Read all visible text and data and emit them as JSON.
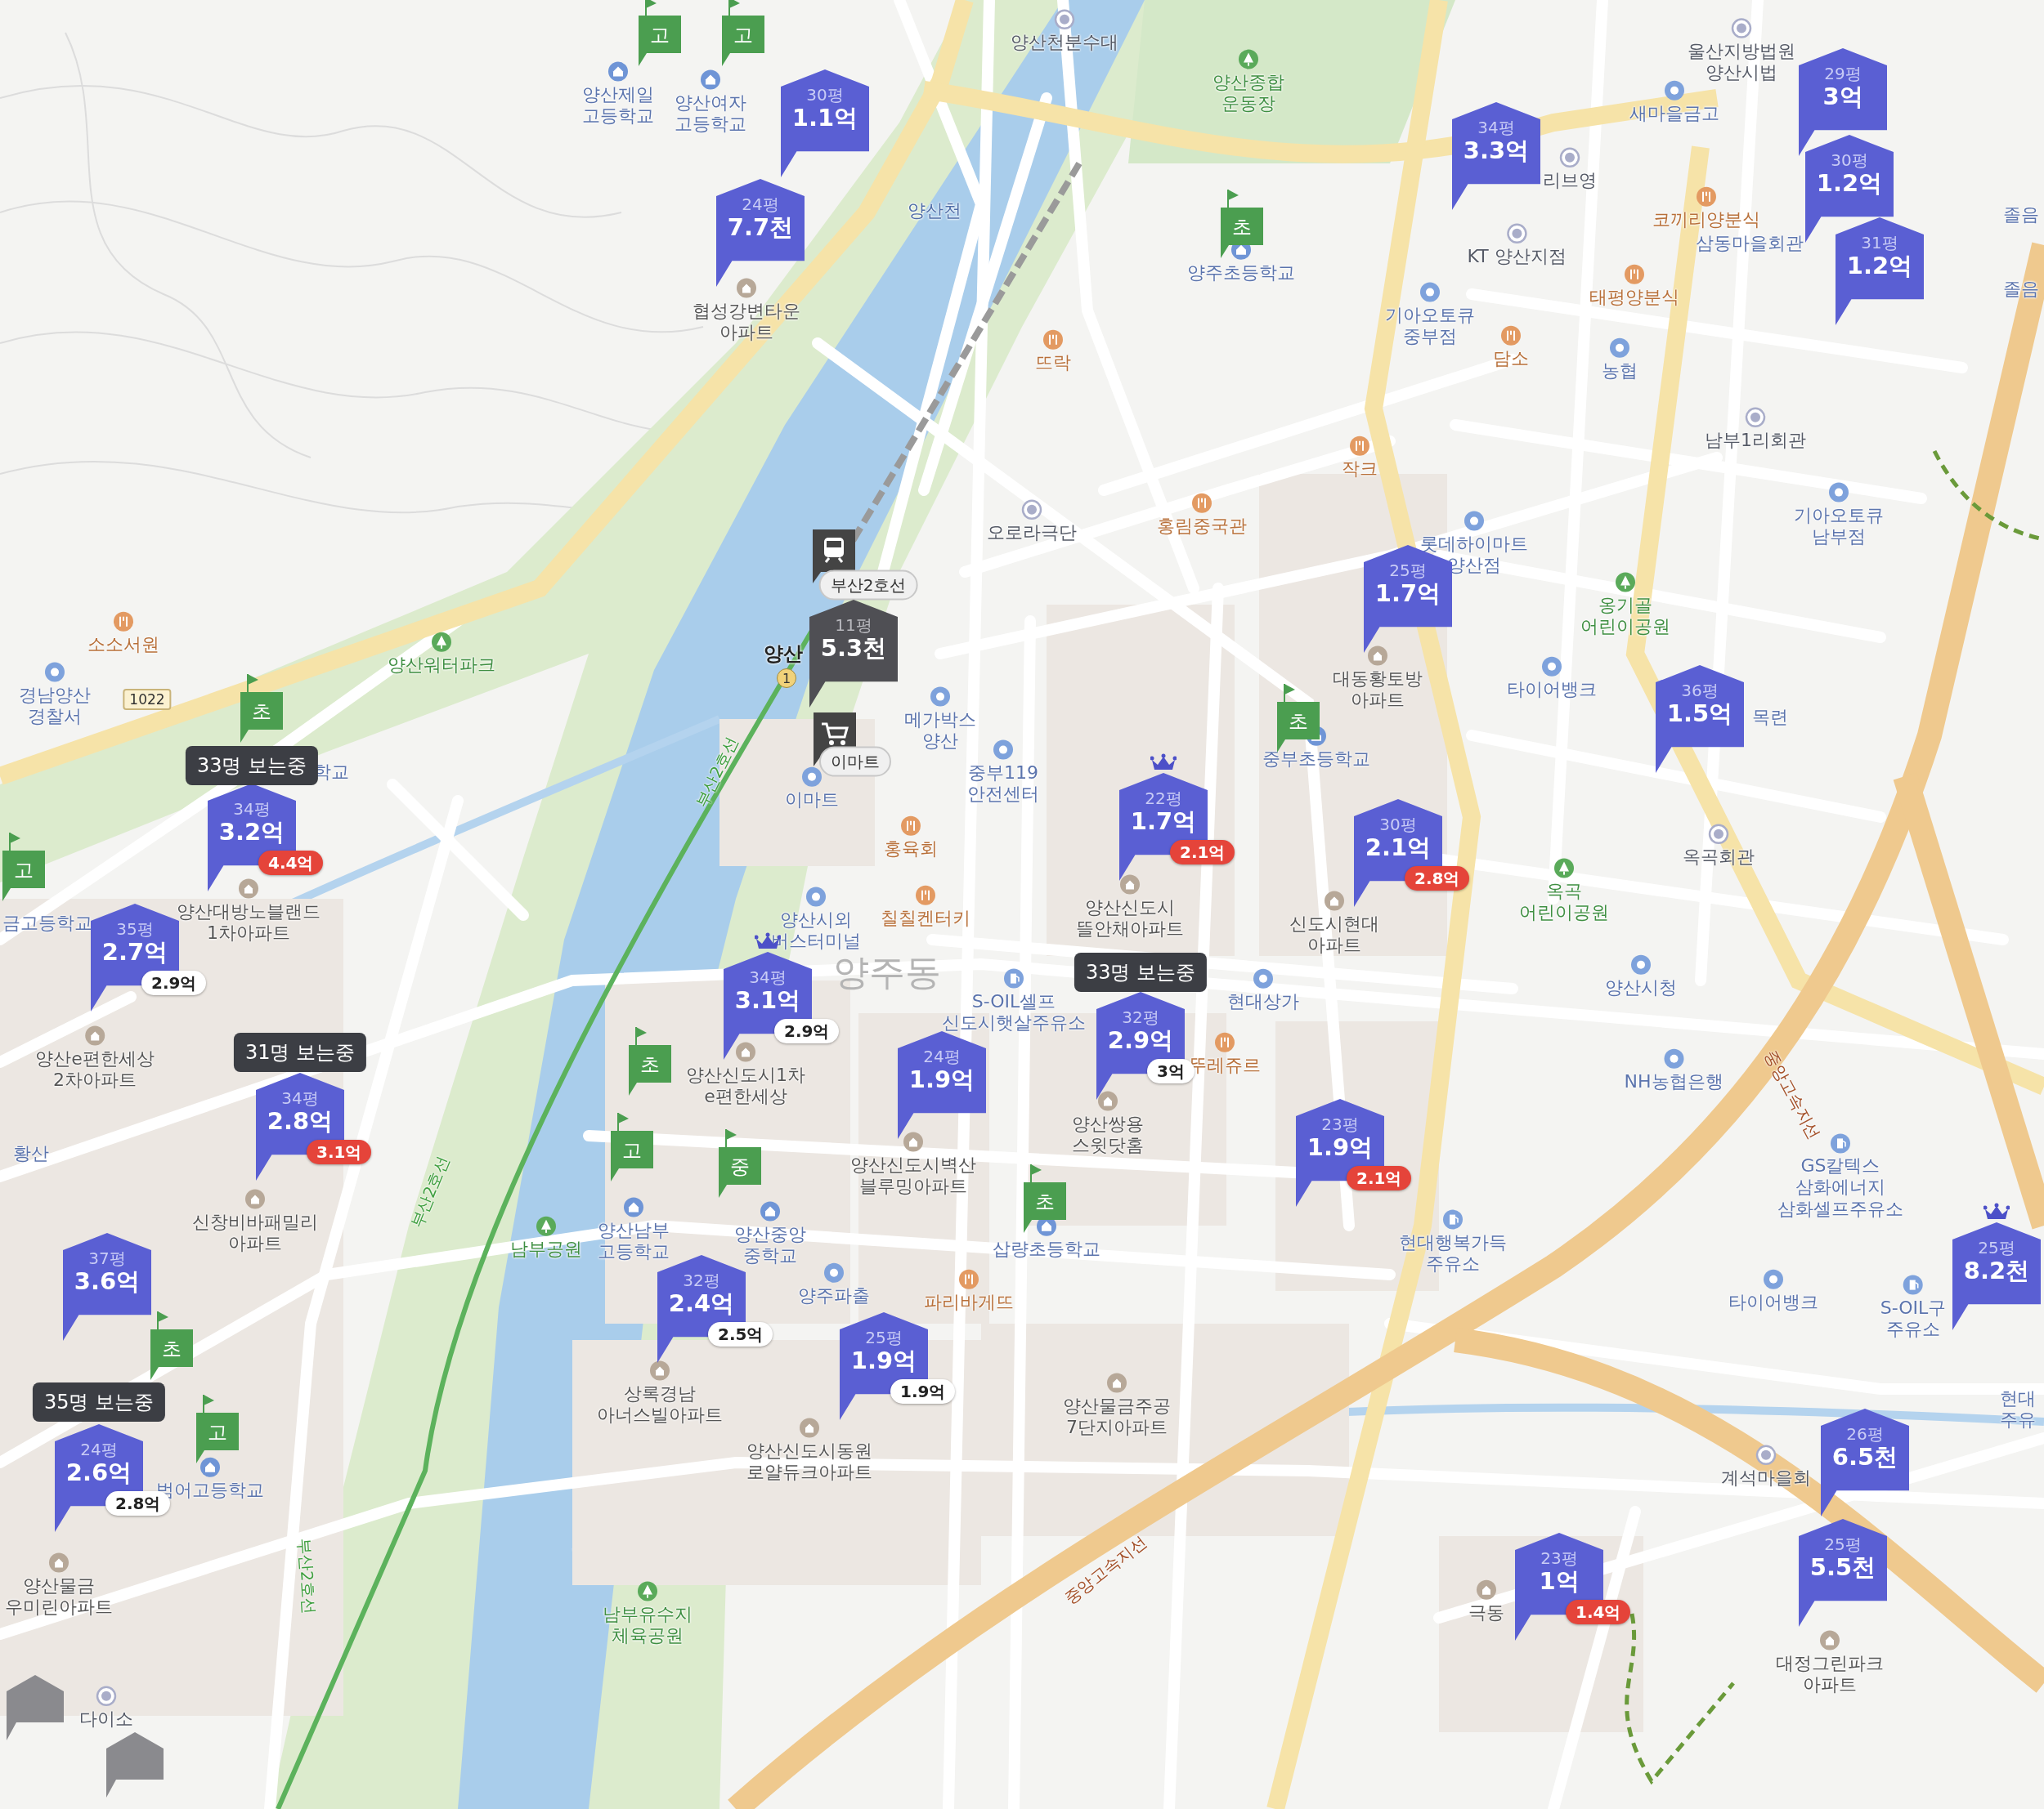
{
  "map": {
    "area_name": "양주동",
    "route_shield": "1022",
    "station": {
      "name": "양산",
      "exit": "1",
      "line_label": "부산2호선",
      "mart_label": "이마트"
    },
    "road_labels": [
      {
        "text": "중앙고속지선"
      },
      {
        "text": "중앙고속지선"
      },
      {
        "text": "부산2호선"
      },
      {
        "text": "부산2호선"
      },
      {
        "text": "부산2호선"
      }
    ],
    "place_labels": [
      {
        "lines": [
          "양산제일",
          "고등학교"
        ],
        "kind": "school"
      },
      {
        "lines": [
          "양산여자",
          "고등학교"
        ],
        "kind": "school"
      },
      {
        "lines": [
          "양산천분수대"
        ],
        "kind": "place"
      },
      {
        "lines": [
          "양산종합",
          "운동장"
        ],
        "kind": "park"
      },
      {
        "lines": [
          "협성강변타운",
          "아파트"
        ],
        "kind": "apartment"
      },
      {
        "lines": [
          "양산천"
        ],
        "kind": "water"
      },
      {
        "lines": [
          "양주초등학교"
        ],
        "kind": "school"
      },
      {
        "lines": [
          "리브영"
        ],
        "kind": "place"
      },
      {
        "lines": [
          "새마을금고"
        ],
        "kind": "public"
      },
      {
        "lines": [
          "울산지방법원",
          "양산시법"
        ],
        "kind": "place"
      },
      {
        "lines": [
          "코끼리양분식"
        ],
        "kind": "food"
      },
      {
        "lines": [
          "KT 양산지점"
        ],
        "kind": "place"
      },
      {
        "lines": [
          "태평양분식"
        ],
        "kind": "food"
      },
      {
        "lines": [
          "기아오토큐",
          "중부점"
        ],
        "kind": "public"
      },
      {
        "lines": [
          "담소"
        ],
        "kind": "food"
      },
      {
        "lines": [
          "농협"
        ],
        "kind": "public"
      },
      {
        "lines": [
          "삼동마을회관"
        ],
        "kind": "fragment"
      },
      {
        "lines": [
          "남부1리회관"
        ],
        "kind": "place"
      },
      {
        "lines": [
          "뜨락"
        ],
        "kind": "food"
      },
      {
        "lines": [
          "작크"
        ],
        "kind": "food"
      },
      {
        "lines": [
          "오로라극단"
        ],
        "kind": "place"
      },
      {
        "lines": [
          "홍림중국관"
        ],
        "kind": "food"
      },
      {
        "lines": [
          "기아오토큐",
          "남부점"
        ],
        "kind": "public"
      },
      {
        "lines": [
          "롯데하이마트",
          "양산점"
        ],
        "kind": "public"
      },
      {
        "lines": [
          "옹기골",
          "어린이공원"
        ],
        "kind": "park"
      },
      {
        "lines": [
          "대동황토방",
          "아파트"
        ],
        "kind": "apartment"
      },
      {
        "lines": [
          "타이어뱅크"
        ],
        "kind": "public"
      },
      {
        "lines": [
          "중부초등학교"
        ],
        "kind": "school"
      },
      {
        "lines": [
          "옥곡회관"
        ],
        "kind": "place"
      },
      {
        "lines": [
          "옥곡",
          "어린이공원"
        ],
        "kind": "park"
      },
      {
        "lines": [
          "양산시청"
        ],
        "kind": "public"
      },
      {
        "lines": [
          "NH농협은행"
        ],
        "kind": "public"
      },
      {
        "lines": [
          "GS칼텍스",
          "삼화에너지",
          "삼화셀프주유소"
        ],
        "kind": "fuel"
      },
      {
        "lines": [
          "타이어뱅크"
        ],
        "kind": "public"
      },
      {
        "lines": [
          "S-OIL구",
          "주유소"
        ],
        "kind": "fuel"
      },
      {
        "lines": [
          "현대행복가득",
          "주유소"
        ],
        "kind": "fuel"
      },
      {
        "lines": [
          "현대",
          "주유"
        ],
        "kind": "fragment"
      },
      {
        "lines": [
          "계석마을회"
        ],
        "kind": "place"
      },
      {
        "lines": [
          "대정그린파크",
          "아파트"
        ],
        "kind": "apartment"
      },
      {
        "lines": [
          "극동"
        ],
        "kind": "apartment"
      },
      {
        "lines": [
          "양산신도시",
          "뜰안채아파트"
        ],
        "kind": "apartment"
      },
      {
        "lines": [
          "신도시현대",
          "아파트"
        ],
        "kind": "apartment"
      },
      {
        "lines": [
          "현대상가"
        ],
        "kind": "public"
      },
      {
        "lines": [
          "뚜레쥬르"
        ],
        "kind": "food"
      },
      {
        "lines": [
          "양산쌍용",
          "스윗닷홈"
        ],
        "kind": "apartment"
      },
      {
        "lines": [
          "양산신도시벽산",
          "블루밍아파트"
        ],
        "kind": "apartment"
      },
      {
        "lines": [
          "양산남부",
          "고등학교"
        ],
        "kind": "school"
      },
      {
        "lines": [
          "양산중앙",
          "중학교"
        ],
        "kind": "school"
      },
      {
        "lines": [
          "삽량초등학교"
        ],
        "kind": "school"
      },
      {
        "lines": [
          "양산신도시1차",
          "e편한세상"
        ],
        "kind": "apartment"
      },
      {
        "lines": [
          "양산시외",
          "버스터미널"
        ],
        "kind": "public"
      },
      {
        "lines": [
          "칠칠켄터키"
        ],
        "kind": "food"
      },
      {
        "lines": [
          "S-OIL셀프",
          "신도시햇살주유소"
        ],
        "kind": "fuel"
      },
      {
        "lines": [
          "홍육회"
        ],
        "kind": "food"
      },
      {
        "lines": [
          "이마트"
        ],
        "kind": "public"
      },
      {
        "lines": [
          "중부119",
          "안전센터"
        ],
        "kind": "public"
      },
      {
        "lines": [
          "메가박스",
          "양산"
        ],
        "kind": "public"
      },
      {
        "lines": [
          "양산워터파크"
        ],
        "kind": "park"
      },
      {
        "lines": [
          "소소서원"
        ],
        "kind": "food"
      },
      {
        "lines": [
          "경남양산",
          "경찰서"
        ],
        "kind": "public"
      },
      {
        "lines": [
          "양산대방노블랜드",
          "1차아파트"
        ],
        "kind": "apartment"
      },
      {
        "lines": [
          "학교"
        ],
        "kind": "fragment"
      },
      {
        "lines": [
          "금고등학교"
        ],
        "kind": "fragment"
      },
      {
        "lines": [
          "양산e편한세상",
          "2차아파트"
        ],
        "kind": "apartment"
      },
      {
        "lines": [
          "황산"
        ],
        "kind": "fragment"
      },
      {
        "lines": [
          "신창비바패밀리",
          "아파트"
        ],
        "kind": "apartment"
      },
      {
        "lines": [
          "남부공원"
        ],
        "kind": "park"
      },
      {
        "lines": [
          "범어고등학교"
        ],
        "kind": "school"
      },
      {
        "lines": [
          "양산물금",
          "우미린아파트"
        ],
        "kind": "apartment"
      },
      {
        "lines": [
          "상록경남",
          "아너스빌아파트"
        ],
        "kind": "apartment"
      },
      {
        "lines": [
          "양주파출"
        ],
        "kind": "public"
      },
      {
        "lines": [
          "파리바게뜨"
        ],
        "kind": "food"
      },
      {
        "lines": [
          "양산신도시동원",
          "로얄듀크아파트"
        ],
        "kind": "apartment"
      },
      {
        "lines": [
          "양산물금주공",
          "7단지아파트"
        ],
        "kind": "apartment"
      },
      {
        "lines": [
          "남부유수지",
          "체육공원"
        ],
        "kind": "park"
      },
      {
        "lines": [
          "다이소"
        ],
        "kind": "place"
      },
      {
        "lines": [
          "졸음"
        ],
        "kind": "fragment"
      },
      {
        "lines": [
          "졸음"
        ],
        "kind": "fragment"
      },
      {
        "lines": [
          "목련"
        ],
        "kind": "fragment"
      }
    ],
    "school_flags": [
      {
        "grade": "고"
      },
      {
        "grade": "고"
      },
      {
        "grade": "초"
      },
      {
        "grade": "초"
      },
      {
        "grade": "고"
      },
      {
        "grade": "초"
      },
      {
        "grade": "초"
      },
      {
        "grade": "고"
      },
      {
        "grade": "중"
      },
      {
        "grade": "초"
      },
      {
        "grade": "초"
      },
      {
        "grade": "고"
      }
    ],
    "viewer_badges": [
      {
        "text": "33명 보는중"
      },
      {
        "text": "31명 보는중"
      },
      {
        "text": "33명 보는중"
      },
      {
        "text": "35명 보는중"
      }
    ],
    "price_markers": [
      {
        "kind": "listing",
        "area": "30평",
        "price": "1.1억",
        "crown": false
      },
      {
        "kind": "listing",
        "area": "24평",
        "price": "7.7천",
        "crown": false
      },
      {
        "kind": "listing",
        "area": "34평",
        "price": "3.3억",
        "crown": false
      },
      {
        "kind": "listing",
        "area": "29평",
        "price": "3억",
        "crown": false
      },
      {
        "kind": "listing",
        "area": "30평",
        "price": "1.2억",
        "crown": false
      },
      {
        "kind": "listing",
        "area": "31평",
        "price": "1.2억",
        "crown": false
      },
      {
        "kind": "listing",
        "area": "25평",
        "price": "1.7억",
        "crown": false
      },
      {
        "kind": "listing",
        "area": "36평",
        "price": "1.5억",
        "crown": false
      },
      {
        "kind": "muted",
        "area": "11평",
        "price": "5.3천",
        "crown": false
      },
      {
        "kind": "listing",
        "area": "34평",
        "price": "3.2억",
        "crown": false,
        "compare": {
          "price": "4.4억",
          "rising": true
        }
      },
      {
        "kind": "listing",
        "area": "22평",
        "price": "1.7억",
        "crown": true,
        "compare": {
          "price": "2.1억",
          "rising": true
        }
      },
      {
        "kind": "listing",
        "area": "30평",
        "price": "2.1억",
        "crown": false,
        "compare": {
          "price": "2.8억",
          "rising": true
        }
      },
      {
        "kind": "listing",
        "area": "35평",
        "price": "2.7억",
        "crown": false,
        "compare": {
          "price": "2.9억",
          "rising": false
        }
      },
      {
        "kind": "listing",
        "area": "34평",
        "price": "3.1억",
        "crown": true,
        "compare": {
          "price": "2.9억",
          "rising": false
        }
      },
      {
        "kind": "listing",
        "area": "24평",
        "price": "1.9억",
        "crown": false
      },
      {
        "kind": "listing",
        "area": "32평",
        "price": "2.9억",
        "crown": false,
        "compare": {
          "price": "3억",
          "rising": false
        }
      },
      {
        "kind": "listing",
        "area": "34평",
        "price": "2.8억",
        "crown": false,
        "compare": {
          "price": "3.1억",
          "rising": true
        }
      },
      {
        "kind": "listing",
        "area": "23평",
        "price": "1.9억",
        "crown": false,
        "compare": {
          "price": "2.1억",
          "rising": true
        }
      },
      {
        "kind": "listing",
        "area": "37평",
        "price": "3.6억",
        "crown": false
      },
      {
        "kind": "listing",
        "area": "25평",
        "price": "8.2천",
        "crown": true
      },
      {
        "kind": "listing",
        "area": "32평",
        "price": "2.4억",
        "crown": false,
        "compare": {
          "price": "2.5억",
          "rising": false
        }
      },
      {
        "kind": "listing",
        "area": "25평",
        "price": "1.9억",
        "crown": false,
        "compare": {
          "price": "1.9억",
          "rising": false
        }
      },
      {
        "kind": "listing",
        "area": "24평",
        "price": "2.6억",
        "crown": false,
        "compare": {
          "price": "2.8억",
          "rising": false
        }
      },
      {
        "kind": "listing",
        "area": "26평",
        "price": "6.5천",
        "crown": false
      },
      {
        "kind": "listing",
        "area": "25평",
        "price": "5.5천",
        "crown": false
      },
      {
        "kind": "listing",
        "area": "23평",
        "price": "1억",
        "crown": false,
        "compare": {
          "price": "1.4억",
          "rising": true
        }
      }
    ]
  }
}
